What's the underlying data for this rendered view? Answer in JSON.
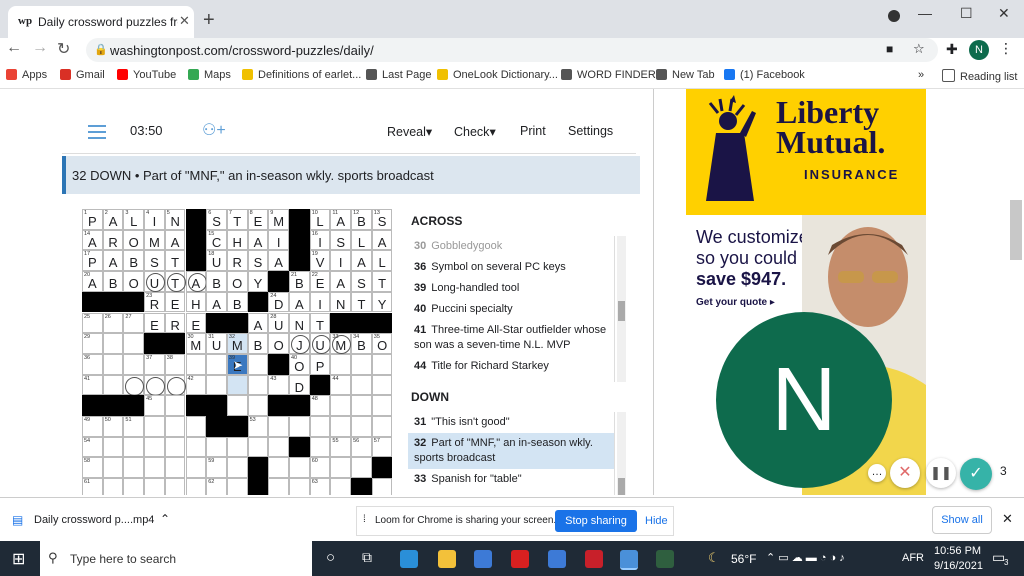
{
  "browser": {
    "tab_title": "Daily crossword puzzles free from",
    "tab_favicon": "wp",
    "url": "washingtonpost.com/crossword-puzzles/daily/",
    "profile_initial": "N"
  },
  "bookmarks": [
    {
      "label": "Apps",
      "icon": "apps-grid-icon",
      "color": "#ea4335"
    },
    {
      "label": "Gmail",
      "icon": "gmail-icon",
      "color": "#d93025"
    },
    {
      "label": "YouTube",
      "icon": "youtube-icon",
      "color": "#ff0000"
    },
    {
      "label": "Maps",
      "icon": "maps-pin-icon",
      "color": "#34a853"
    },
    {
      "label": "Definitions of earlet...",
      "icon": "dictionary-icon",
      "color": "#f0c000"
    },
    {
      "label": "Last Page",
      "icon": "globe-icon",
      "color": "#555555"
    },
    {
      "label": "OneLook Dictionary...",
      "icon": "dictionary-icon",
      "color": "#f0c000"
    },
    {
      "label": "WORD FINDER",
      "icon": "globe-icon",
      "color": "#555555"
    },
    {
      "label": "New Tab",
      "icon": "globe-icon",
      "color": "#555555"
    },
    {
      "label": "(1) Facebook",
      "icon": "facebook-icon",
      "color": "#1877f2"
    }
  ],
  "reading_list": "Reading list",
  "puzzle": {
    "timer": "03:50",
    "menu": [
      "Reveal",
      "Check",
      "Print",
      "Settings"
    ],
    "active_clue": "32 DOWN • Part of \"MNF,\" an in-season wkly. sports broadcast",
    "across_heading": "ACROSS",
    "down_heading": "DOWN",
    "across_clues": [
      {
        "num": "30",
        "text": "Gobbledygook",
        "dim": true
      },
      {
        "num": "36",
        "text": "Symbol on several PC keys"
      },
      {
        "num": "39",
        "text": "Long-handled tool"
      },
      {
        "num": "40",
        "text": "Puccini specialty"
      },
      {
        "num": "41",
        "text": "Three-time All-Star outfielder whose son was a seven-time N.L. MVP"
      },
      {
        "num": "44",
        "text": "Title for Richard Starkey"
      }
    ],
    "down_clues": [
      {
        "num": "31",
        "text": "\"This isn't good\""
      },
      {
        "num": "32",
        "text": "Part of \"MNF,\" an in-season wkly. sports broadcast",
        "active": true
      },
      {
        "num": "33",
        "text": "Spanish for \"table\""
      }
    ],
    "grid_rows": [
      "PALIN#STEM#LABS",
      "AROMA#CHAI#ISLA",
      "PABST#URSA#VIAL",
      "ABOUTABOY#BEAST",
      "###REHAB#DAINTY",
      "...ERE##AUNT###",
      "...##MUMBOJUMBO",
      ".......E.#OP...",
      "..........D#...",
      "###..##..##....",
      "......##.......",
      "..........#....",
      "........#.....#",
      "........#....#."
    ],
    "grid_numbers": [
      [
        0,
        0,
        "1"
      ],
      [
        0,
        1,
        "2"
      ],
      [
        0,
        2,
        "3"
      ],
      [
        0,
        3,
        "4"
      ],
      [
        0,
        4,
        "5"
      ],
      [
        0,
        6,
        "6"
      ],
      [
        0,
        7,
        "7"
      ],
      [
        0,
        8,
        "8"
      ],
      [
        0,
        9,
        "9"
      ],
      [
        0,
        11,
        "10"
      ],
      [
        0,
        12,
        "11"
      ],
      [
        0,
        13,
        "12"
      ],
      [
        0,
        14,
        "13"
      ],
      [
        1,
        0,
        "14"
      ],
      [
        1,
        6,
        "15"
      ],
      [
        1,
        11,
        "16"
      ],
      [
        2,
        0,
        "17"
      ],
      [
        2,
        6,
        "18"
      ],
      [
        2,
        11,
        "19"
      ],
      [
        3,
        0,
        "20"
      ],
      [
        3,
        10,
        "21"
      ],
      [
        3,
        11,
        "22"
      ],
      [
        4,
        3,
        "23"
      ],
      [
        4,
        9,
        "24"
      ],
      [
        5,
        0,
        "25"
      ],
      [
        5,
        1,
        "26"
      ],
      [
        5,
        2,
        "27"
      ],
      [
        5,
        9,
        "28"
      ],
      [
        6,
        0,
        "29"
      ],
      [
        6,
        5,
        "30"
      ],
      [
        6,
        6,
        "31"
      ],
      [
        6,
        7,
        "32"
      ],
      [
        6,
        12,
        "33"
      ],
      [
        6,
        13,
        "34"
      ],
      [
        6,
        14,
        "35"
      ],
      [
        7,
        0,
        "36"
      ],
      [
        7,
        3,
        "37"
      ],
      [
        7,
        4,
        "38"
      ],
      [
        7,
        7,
        "39"
      ],
      [
        7,
        10,
        "40"
      ],
      [
        8,
        0,
        "41"
      ],
      [
        8,
        5,
        "42"
      ],
      [
        8,
        9,
        "43"
      ],
      [
        8,
        12,
        "44"
      ],
      [
        9,
        3,
        "45"
      ],
      [
        9,
        9,
        "46"
      ],
      [
        9,
        10,
        "47"
      ],
      [
        9,
        11,
        "48"
      ],
      [
        10,
        0,
        "49"
      ],
      [
        10,
        1,
        "50"
      ],
      [
        10,
        2,
        "51"
      ],
      [
        10,
        7,
        "52"
      ],
      [
        10,
        8,
        "53"
      ],
      [
        11,
        0,
        "54"
      ],
      [
        11,
        12,
        "55"
      ],
      [
        11,
        13,
        "56"
      ],
      [
        11,
        14,
        "57"
      ],
      [
        12,
        0,
        "58"
      ],
      [
        12,
        6,
        "59"
      ],
      [
        12,
        11,
        "60"
      ],
      [
        13,
        0,
        "61"
      ],
      [
        13,
        6,
        "62"
      ],
      [
        13,
        11,
        "63"
      ]
    ],
    "circles": [
      [
        3,
        3
      ],
      [
        3,
        4
      ],
      [
        3,
        5
      ],
      [
        6,
        10
      ],
      [
        6,
        11
      ],
      [
        6,
        12
      ],
      [
        8,
        2
      ],
      [
        8,
        3
      ],
      [
        8,
        4
      ]
    ],
    "highlight_cells": [
      [
        6,
        7
      ],
      [
        7,
        7
      ],
      [
        8,
        7
      ]
    ],
    "selected_cell": [
      7,
      7
    ]
  },
  "ad": {
    "brand": "Liberty\nMutual.",
    "brand_sub": "INSURANCE",
    "line1": "We customize",
    "line2": "so you could",
    "line3": "save $947.",
    "cta": "Get your quote ▸"
  },
  "loom_overlay_initial": "N",
  "download_shelf": {
    "file": "Daily crossword p....mp4",
    "loom_message": "Loom for Chrome is sharing your screen.",
    "stop_label": "Stop sharing",
    "hide_label": "Hide",
    "show_all": "Show all"
  },
  "taskbar": {
    "search_placeholder": "Type here to search",
    "weather": "56°F",
    "lang": "AFR",
    "time": "10:56 PM",
    "date": "9/16/2021",
    "notifications": "3"
  }
}
